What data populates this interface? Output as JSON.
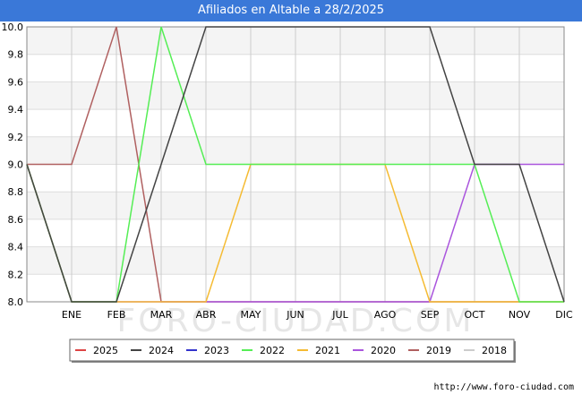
{
  "title": "Afiliados en Altable a 28/2/2025",
  "footer": "http://www.foro-ciudad.com",
  "watermark": "FORO-CIUDAD.COM",
  "chart_data": {
    "type": "line",
    "categories": [
      "ENE",
      "FEB",
      "MAR",
      "ABR",
      "MAY",
      "JUN",
      "JUL",
      "AGO",
      "SEP",
      "OCT",
      "NOV",
      "DIC"
    ],
    "x_start_value": 9.0,
    "ylim": [
      8.0,
      10.0
    ],
    "yticks": [
      "8.0",
      "8.2",
      "8.4",
      "8.6",
      "8.8",
      "9.0",
      "9.2",
      "9.4",
      "9.6",
      "9.8",
      "10.0"
    ],
    "grid": true,
    "legend_position": "bottom",
    "series": [
      {
        "name": "2025",
        "color": "#dd4444",
        "values": [
          null,
          null,
          null,
          null,
          null,
          null,
          null,
          null,
          null,
          null,
          null,
          null
        ]
      },
      {
        "name": "2024",
        "color": "#444444",
        "values": [
          8,
          8,
          9,
          10,
          10,
          10,
          10,
          10,
          10,
          9,
          9,
          8
        ]
      },
      {
        "name": "2023",
        "color": "#3333cc",
        "values": [
          null,
          null,
          null,
          null,
          null,
          null,
          null,
          null,
          null,
          null,
          null,
          null
        ]
      },
      {
        "name": "2022",
        "color": "#55ee55",
        "values": [
          8,
          8,
          10,
          9,
          9,
          9,
          9,
          9,
          9,
          9,
          8,
          8
        ]
      },
      {
        "name": "2021",
        "color": "#f5bb33",
        "values": [
          8,
          8,
          8,
          8,
          9,
          9,
          9,
          9,
          8,
          8,
          8,
          8
        ]
      },
      {
        "name": "2020",
        "color": "#aa55dd",
        "values": [
          8,
          8,
          8,
          8,
          8,
          8,
          8,
          8,
          8,
          9,
          9,
          9
        ]
      },
      {
        "name": "2019",
        "color": "#b06060",
        "values": [
          9,
          10,
          8,
          8,
          8,
          8,
          8,
          8,
          8,
          8,
          8,
          8
        ]
      },
      {
        "name": "2018",
        "color": "#cccccc",
        "values": [
          null,
          null,
          null,
          null,
          null,
          null,
          null,
          null,
          null,
          null,
          null,
          null
        ]
      }
    ]
  }
}
